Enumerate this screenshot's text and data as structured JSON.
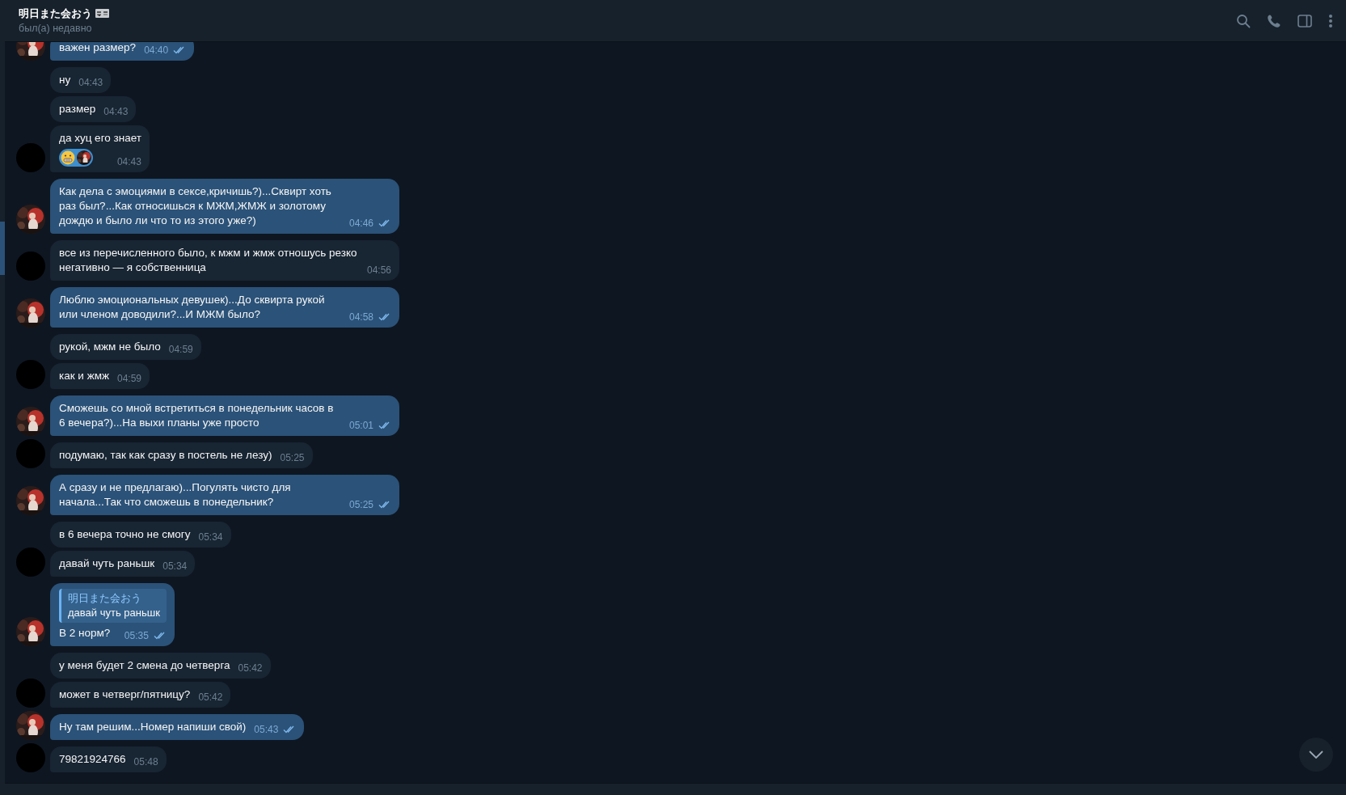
{
  "header": {
    "title": "明日また会おう",
    "status": "был(а) недавно"
  },
  "messages": [
    {
      "kind": "out",
      "text": "важен размер?",
      "time": "04:40",
      "read": true,
      "avatar": true
    },
    {
      "kind": "in",
      "text": "ну",
      "time": "04:43",
      "avatar": false
    },
    {
      "kind": "in",
      "text": "размер",
      "time": "04:43",
      "avatar": false
    },
    {
      "kind": "in",
      "text": "да хуц его знает",
      "time": "04:43",
      "avatar": true,
      "reactions": true
    },
    {
      "kind": "out",
      "text": "Как дела с эмоциями в сексе,кричишь?)...Сквирт хоть раз был?...Как относишься к МЖМ,ЖМЖ и золотому дождю и было ли что то из этого уже?)",
      "time": "04:46",
      "read": true,
      "avatar": true
    },
    {
      "kind": "in",
      "text": "все из перечисленного было, к мжм и жмж отношусь резко негативно — я собственница",
      "time": "04:56",
      "avatar": true
    },
    {
      "kind": "out",
      "text": "Люблю эмоциональных девушек)...До сквирта рукой или членом доводили?...И МЖМ было?",
      "time": "04:58",
      "read": true,
      "avatar": true
    },
    {
      "kind": "in",
      "text": "рукой, мжм не было",
      "time": "04:59",
      "avatar": false
    },
    {
      "kind": "in",
      "text": "как и жмж",
      "time": "04:59",
      "avatar": true
    },
    {
      "kind": "out",
      "text": "Сможешь со мной встретиться в понедельник часов в 6 вечера?)...На выхи планы уже просто",
      "time": "05:01",
      "read": true,
      "avatar": true
    },
    {
      "kind": "in",
      "text": "подумаю, так как сразу в постель не лезу)",
      "time": "05:25",
      "avatar": true
    },
    {
      "kind": "out",
      "text": "А сразу и не предлагаю)...Погулять чисто для начала...Так что сможешь в понедельник?",
      "time": "05:25",
      "read": true,
      "avatar": true
    },
    {
      "kind": "in",
      "text": "в 6 вечера точно не смогу",
      "time": "05:34",
      "avatar": false
    },
    {
      "kind": "in",
      "text": "давай чуть раньшк",
      "time": "05:34",
      "avatar": true
    },
    {
      "kind": "out",
      "reply": {
        "name": "明日また会おう",
        "text": "давай чуть раньшк"
      },
      "text": "В 2 норм?",
      "time": "05:35",
      "read": true,
      "avatar": true
    },
    {
      "kind": "in",
      "text": "у меня будет 2 смена до четверга",
      "time": "05:42",
      "avatar": false
    },
    {
      "kind": "in",
      "text": "может в четверг/пятницу?",
      "time": "05:42",
      "avatar": true
    },
    {
      "kind": "out",
      "text": "Ну там решим...Номер напиши свой)",
      "time": "05:43",
      "read": true,
      "avatar": true
    },
    {
      "kind": "in",
      "text": "79821924766",
      "time": "05:48",
      "avatar": true
    }
  ]
}
